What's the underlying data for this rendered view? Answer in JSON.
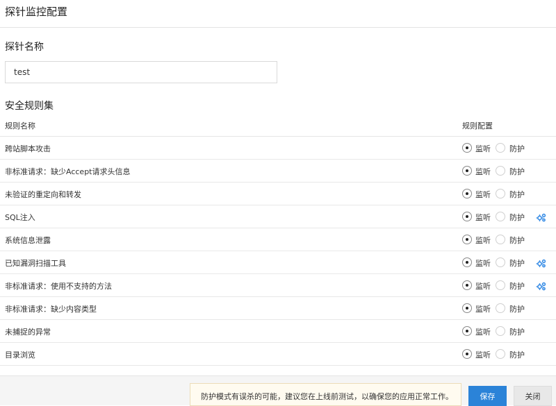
{
  "page": {
    "title": "探针监控配置"
  },
  "probe": {
    "section_title": "探针名称",
    "name_value": "test"
  },
  "ruleset": {
    "section_title": "安全规则集",
    "col_name": "规则名称",
    "col_config": "规则配置",
    "monitor_label": "监听",
    "protect_label": "防护",
    "rules": [
      {
        "name": "跨站脚本攻击",
        "mode": "monitor",
        "has_config": false
      },
      {
        "name": "非标准请求：缺少Accept请求头信息",
        "mode": "monitor",
        "has_config": false
      },
      {
        "name": "未验证的重定向和转发",
        "mode": "monitor",
        "has_config": false
      },
      {
        "name": "SQL注入",
        "mode": "monitor",
        "has_config": true
      },
      {
        "name": "系统信息泄露",
        "mode": "monitor",
        "has_config": false
      },
      {
        "name": "已知漏洞扫描工具",
        "mode": "monitor",
        "has_config": true
      },
      {
        "name": "非标准请求：使用不支持的方法",
        "mode": "monitor",
        "has_config": true
      },
      {
        "name": "非标准请求：缺少内容类型",
        "mode": "monitor",
        "has_config": false
      },
      {
        "name": "未捕捉的异常",
        "mode": "monitor",
        "has_config": false
      },
      {
        "name": "目录浏览",
        "mode": "monitor",
        "has_config": false
      }
    ]
  },
  "footer": {
    "notice": "防护模式有误杀的可能，建议您在上线前测试，以确保您的应用正常工作。",
    "save_label": "保存",
    "close_label": "关闭"
  },
  "colors": {
    "primary": "#2b83d8",
    "gear_icon": "#3a8ee6",
    "notice_bg": "#fffbf0"
  },
  "icons": {
    "config": "gear-icon"
  }
}
